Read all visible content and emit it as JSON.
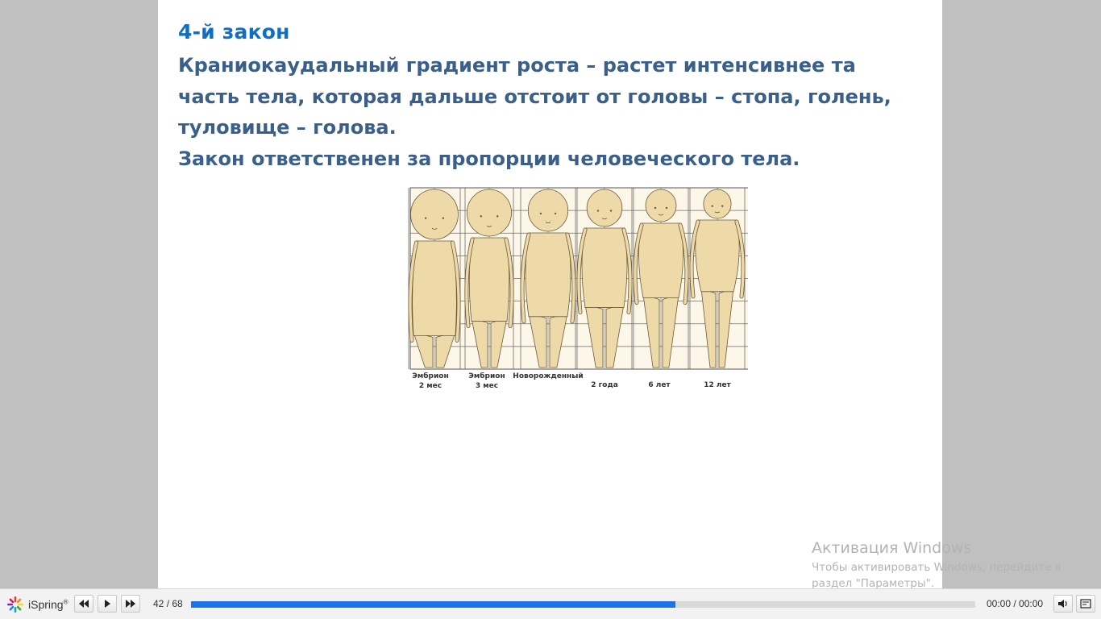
{
  "slide": {
    "heading": "4-й  закон",
    "body_lines": [
      "Краниокаудальный градиент роста – растет интенсивнее та",
      "часть  тела, которая дальше отстоит от головы – стопа, голень,",
      "туловище – голова.",
      "Закон ответственен за пропорции человеческого тела."
    ],
    "figure": {
      "captions": [
        {
          "line1": "Эмбрион",
          "line2": "2 мес"
        },
        {
          "line1": "Эмбрион",
          "line2": "3 мес"
        },
        {
          "line1": "Новорожденный",
          "line2": ""
        },
        {
          "line1": "",
          "line2": "2 года"
        },
        {
          "line1": "",
          "line2": "6 лет"
        },
        {
          "line1": "",
          "line2": "12 лет"
        }
      ]
    }
  },
  "watermark": {
    "title": "Активация Windows",
    "line1": "Чтобы активировать Windows, перейдите в",
    "line2": "раздел \"Параметры\"."
  },
  "player": {
    "logo_text": "iSpring",
    "current_slide": "42",
    "total_slides": "68",
    "counter_sep": " / ",
    "progress_fraction": 0.6176,
    "time_current": "00:00",
    "time_total": "00:00",
    "time_sep": " / ",
    "colors": {
      "progress": "#1a73e8",
      "heading": "#0f6fc6",
      "body": "#3a5f8a"
    }
  }
}
